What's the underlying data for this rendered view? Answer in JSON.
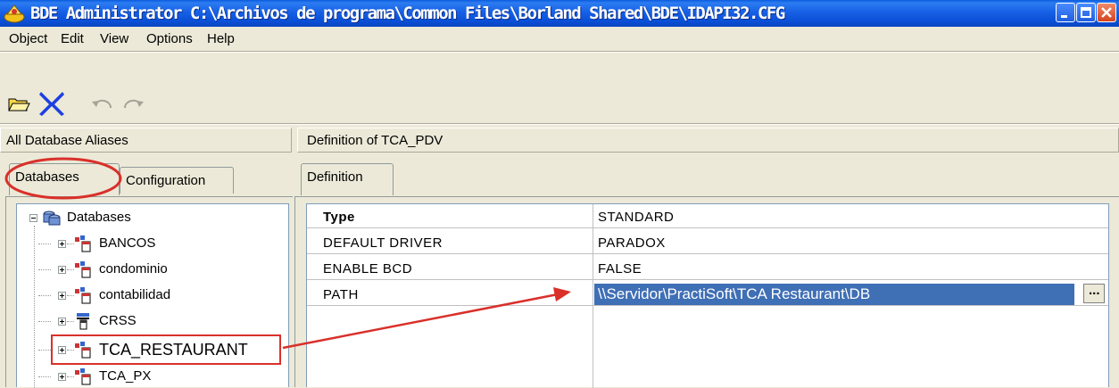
{
  "window": {
    "title": "BDE Administrator  C:\\Archivos de programa\\Common Files\\Borland Shared\\BDE\\IDAPI32.CFG"
  },
  "menu": [
    "Object",
    "Edit",
    "View",
    "Options",
    "Help"
  ],
  "left_header": "All Database Aliases",
  "right_header": "Definition of TCA_PDV",
  "tabs_left": [
    "Databases",
    "Configuration"
  ],
  "tab_right": "Definition",
  "tree": {
    "root": "Databases",
    "items": [
      "BANCOS",
      "condominio",
      "contabilidad",
      "CRSS",
      "TCA_RESTAURANT",
      "TCA_PX"
    ]
  },
  "definition": {
    "rows": [
      {
        "key": "Type",
        "value": "STANDARD"
      },
      {
        "key": "DEFAULT DRIVER",
        "value": "PARADOX"
      },
      {
        "key": "ENABLE BCD",
        "value": "FALSE"
      },
      {
        "key": "PATH",
        "value": "\\\\Servidor\\PractiSoft\\TCA Restaurant\\DB"
      }
    ],
    "ellipsis": "..."
  },
  "colors": {
    "highlight": "#d9302a",
    "selection": "#3f6fb5"
  }
}
